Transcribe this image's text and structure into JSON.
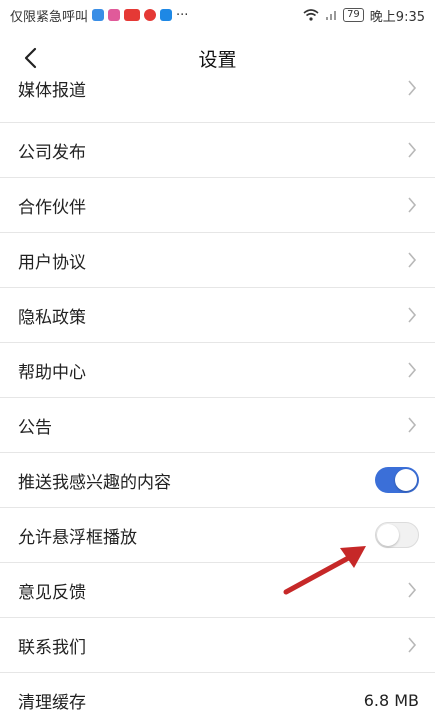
{
  "status_bar": {
    "carrier": "仅限紧急呼叫",
    "more": "···",
    "battery": "79",
    "time": "晚上9:35"
  },
  "header": {
    "title": "设置"
  },
  "settings": [
    {
      "label": "媒体报道",
      "type": "link"
    },
    {
      "label": "公司发布",
      "type": "link"
    },
    {
      "label": "合作伙伴",
      "type": "link"
    },
    {
      "label": "用户协议",
      "type": "link"
    },
    {
      "label": "隐私政策",
      "type": "link"
    },
    {
      "label": "帮助中心",
      "type": "link"
    },
    {
      "label": "公告",
      "type": "link"
    },
    {
      "label": "推送我感兴趣的内容",
      "type": "toggle",
      "on": true
    },
    {
      "label": "允许悬浮框播放",
      "type": "toggle",
      "on": false
    },
    {
      "label": "意见反馈",
      "type": "link"
    },
    {
      "label": "联系我们",
      "type": "link"
    },
    {
      "label": "清理缓存",
      "type": "value",
      "value": "6.8 MB"
    }
  ],
  "colors": {
    "toggle_on": "#3b6fd8",
    "annotation_arrow": "#c62828"
  }
}
